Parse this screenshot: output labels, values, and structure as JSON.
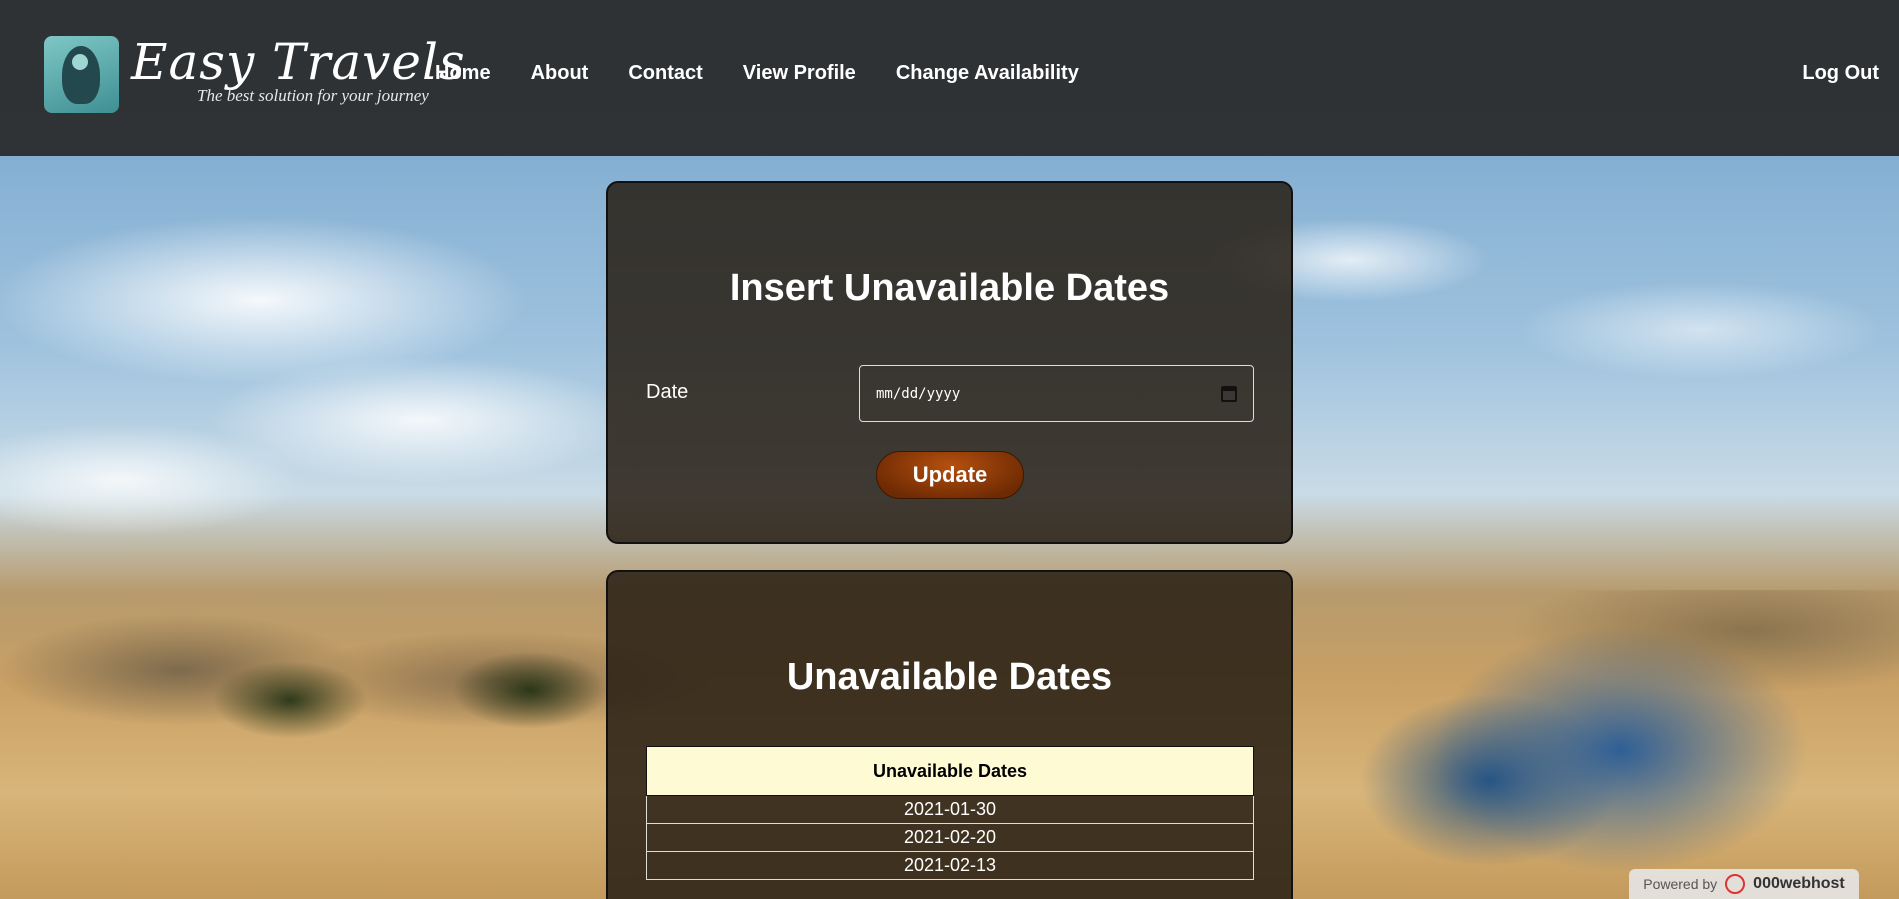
{
  "brand": {
    "title": "Easy Travels",
    "tagline": "The best solution for your journey"
  },
  "nav": {
    "items": [
      "Home",
      "About",
      "Contact",
      "View Profile",
      "Change Availability"
    ],
    "logout": "Log Out"
  },
  "insert_panel": {
    "title": "Insert Unavailable Dates",
    "date_label": "Date",
    "date_placeholder": "mm/dd/yyyy",
    "button_label": "Update"
  },
  "list_panel": {
    "title": "Unavailable Dates",
    "table_header": "Unavailable Dates",
    "rows": [
      "2021-01-30",
      "2021-02-20",
      "2021-02-13"
    ]
  },
  "footer_badge": {
    "prefix": "Powered by",
    "host": "000webhost"
  }
}
